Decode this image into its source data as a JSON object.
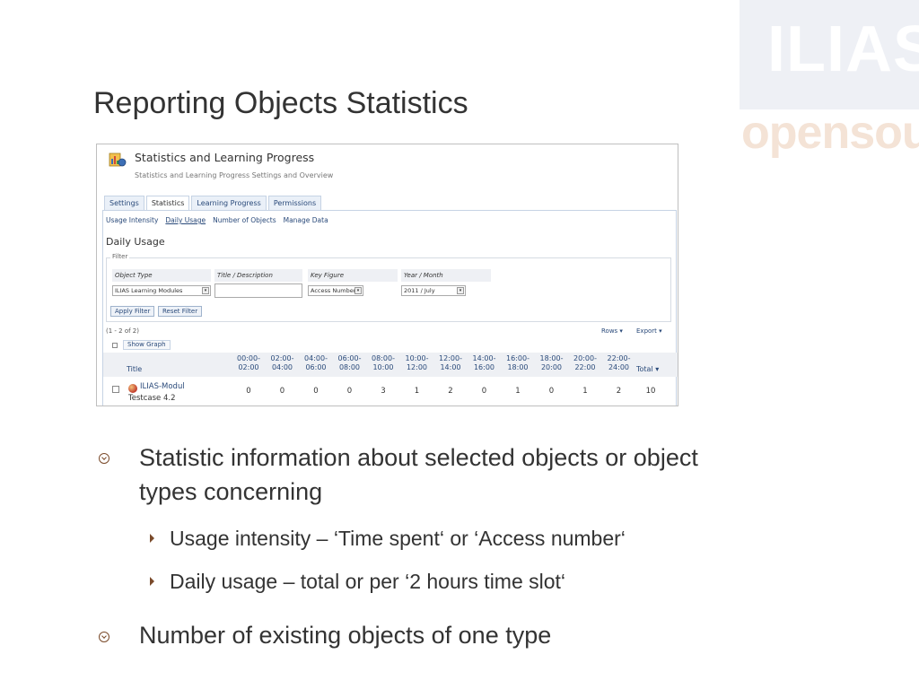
{
  "logo": {
    "line1": "ILIAS",
    "line2": "opensource"
  },
  "slide": {
    "title": "Reporting Objects Statistics"
  },
  "screenshot": {
    "app_title": "Statistics and Learning Progress",
    "app_subtitle": "Statistics and Learning Progress Settings and Overview",
    "tabs": [
      "Settings",
      "Statistics",
      "Learning Progress",
      "Permissions"
    ],
    "subtabs": [
      "Usage Intensity",
      "Daily Usage",
      "Number of Objects",
      "Manage Data"
    ],
    "panel_title": "Daily Usage",
    "filter": {
      "legend": "Filter",
      "object_type_label": "Object Type",
      "object_type_value": "ILIAS Learning Modules",
      "title_label": "Title / Description",
      "title_value": "",
      "key_figure_label": "Key Figure",
      "key_figure_value": "Access Number",
      "year_month_label": "Year / Month",
      "year_month_value": "2011 / July",
      "apply_label": "Apply Filter",
      "reset_label": "Reset Filter"
    },
    "table": {
      "range": "(1 - 2 of 2)",
      "rows_label": "Rows ▾",
      "export_label": "Export ▾",
      "show_graph": "Show Graph",
      "title_col": "Title",
      "slots": [
        {
          "a": "00:00-",
          "b": "02:00"
        },
        {
          "a": "02:00-",
          "b": "04:00"
        },
        {
          "a": "04:00-",
          "b": "06:00"
        },
        {
          "a": "06:00-",
          "b": "08:00"
        },
        {
          "a": "08:00-",
          "b": "10:00"
        },
        {
          "a": "10:00-",
          "b": "12:00"
        },
        {
          "a": "12:00-",
          "b": "14:00"
        },
        {
          "a": "14:00-",
          "b": "16:00"
        },
        {
          "a": "16:00-",
          "b": "18:00"
        },
        {
          "a": "18:00-",
          "b": "20:00"
        },
        {
          "a": "20:00-",
          "b": "22:00"
        },
        {
          "a": "22:00-",
          "b": "24:00"
        }
      ],
      "total_col": "Total ▾",
      "row": {
        "title_line1": "ILIAS-Modul",
        "title_line2": "Testcase 4.2",
        "values": [
          "0",
          "0",
          "0",
          "0",
          "3",
          "1",
          "2",
          "0",
          "1",
          "0",
          "1",
          "2"
        ],
        "total": "10"
      }
    }
  },
  "bullets": [
    {
      "text_line1": "Statistic information about selected objects or object",
      "text_line2": "types concerning"
    },
    {
      "text": "Number of existing objects of one type"
    }
  ],
  "sub_bullets": [
    "Usage intensity – ‘Time spent‘ or ‘Access number‘",
    "Daily usage – total or per ‘2 hours time slot‘"
  ]
}
